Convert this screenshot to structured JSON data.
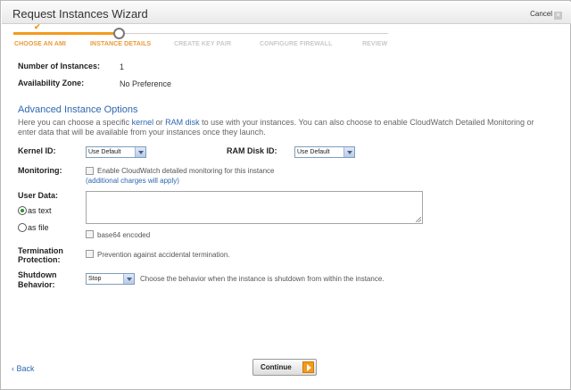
{
  "window": {
    "title": "Request Instances Wizard",
    "cancel_label": "Cancel"
  },
  "steps": [
    {
      "label": "CHOOSE AN AMI",
      "state": "done"
    },
    {
      "label": "INSTANCE DETAILS",
      "state": "current"
    },
    {
      "label": "CREATE KEY PAIR",
      "state": "pending"
    },
    {
      "label": "CONFIGURE FIREWALL",
      "state": "pending"
    },
    {
      "label": "REVIEW",
      "state": "pending"
    }
  ],
  "summary": {
    "instances_label": "Number of Instances:",
    "instances_value": "1",
    "zone_label": "Availability Zone:",
    "zone_value": "No Preference"
  },
  "advanced": {
    "heading": "Advanced Instance Options",
    "desc_pre": "Here you can choose a specific ",
    "desc_kernel": "kernel",
    "desc_or": " or ",
    "desc_ramdisk": "RAM disk",
    "desc_post": " to use with your instances. You can also choose to enable CloudWatch Detailed Monitoring or enter data that will be available from your instances once they launch."
  },
  "fields": {
    "kernel_label": "Kernel ID:",
    "kernel_value": "Use Default",
    "ramdisk_label": "RAM Disk ID:",
    "ramdisk_value": "Use Default",
    "monitoring_label": "Monitoring:",
    "monitoring_text": "Enable CloudWatch detailed monitoring for this instance",
    "monitoring_note": "(additional charges will apply)",
    "userdata_label": "User Data:",
    "as_text": "as text",
    "as_file": "as file",
    "base64_label": "base64 encoded",
    "termination_label_1": "Termination",
    "termination_label_2": "Protection:",
    "termination_text": "Prevention against accidental termination.",
    "shutdown_label_1": "Shutdown",
    "shutdown_label_2": "Behavior:",
    "shutdown_value": "Stop",
    "shutdown_help": "Choose the behavior when the instance is shutdown from within the instance."
  },
  "footer": {
    "back_label": "Back",
    "continue_label": "Continue"
  },
  "colors": {
    "accent_orange": "#f39a1c",
    "link_blue": "#2e67b1"
  }
}
